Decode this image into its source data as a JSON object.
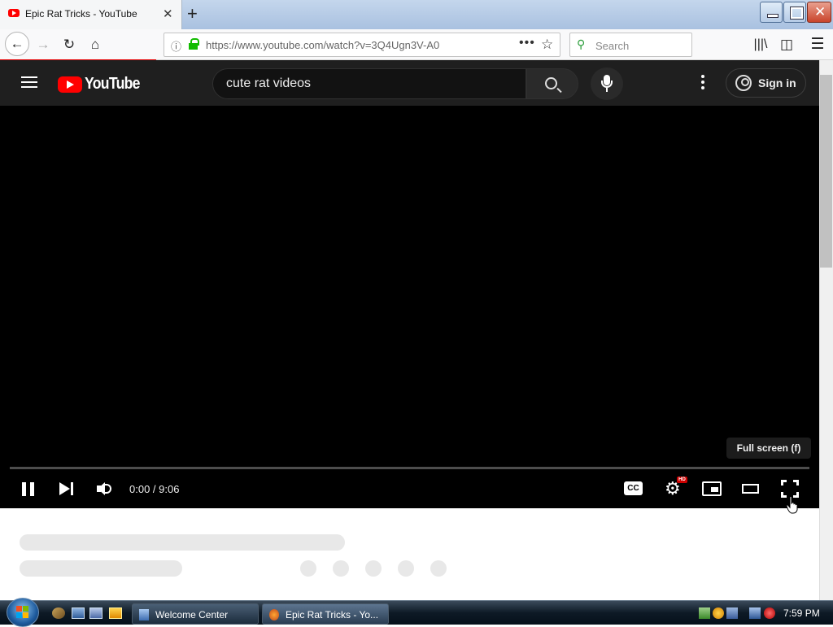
{
  "browser": {
    "tab": {
      "title": "Epic Rat Tricks - YouTube",
      "close": "✕"
    },
    "new_tab": "+",
    "nav": {
      "back": "←",
      "forward": "→",
      "reload": "↻",
      "home": "⌂",
      "library": "\\\\\\",
      "sidebar": "◫",
      "menu": "☰"
    },
    "url": {
      "info": "ⓘ",
      "text": "https://www.youtube.com/watch?v=3Q4Ugn3V-A0",
      "more": "•••",
      "star": "☆"
    },
    "search": {
      "icon": "🔍",
      "placeholder": "Search"
    }
  },
  "youtube": {
    "logo_text": "YouTube",
    "search_query": "cute rat videos",
    "sign_in": "Sign in"
  },
  "player": {
    "tooltip": "Full screen (f)",
    "time": "0:00 / 9:06",
    "progress": 0,
    "cc_label": "CC",
    "settings_icon": "⚙",
    "hd_badge": "HD"
  },
  "taskbar": {
    "items": [
      {
        "label": "Welcome Center"
      },
      {
        "label": "Epic Rat Tricks - Yo..."
      }
    ],
    "clock": "7:59 PM"
  },
  "colors": {
    "youtube_red": "#ff0000",
    "yt_header": "#1f1f1f",
    "player_bg": "#000000",
    "skeleton": "#e8e8e8"
  }
}
